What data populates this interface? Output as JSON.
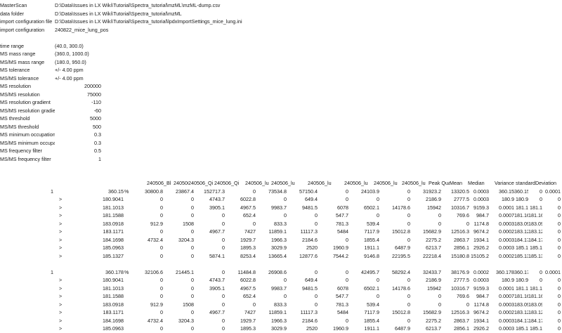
{
  "meta": {
    "MasterScan": "D:\\Data\\Issues in LX Wiki\\Tutorial\\Spectra_tutorial\\mzML\\mzML-dump.csv",
    "data folder": "D:\\Data\\Issues in LX Wiki\\Tutorial\\Spectra_tutorial\\mzML",
    "import configuration file": "D:\\Data\\Issues in LX Wiki\\Tutorial\\Spectra_tutorial\\lpdxImportSettings_mice_lung.ini",
    "import configuration": "240822_mice_lung_pos"
  },
  "meta_order": [
    "MasterScan",
    "data folder",
    "import configuration file",
    "import configuration"
  ],
  "meta_labels": [
    "MasterScan",
    "data folder",
    "import configuration file",
    "import configuration"
  ],
  "params": [
    {
      "label": "time range",
      "value": "(40.0, 300.0)",
      "align": "l"
    },
    {
      "label": "MS mass range",
      "value": "(360.0, 1000.0)",
      "align": "l"
    },
    {
      "label": "MS/MS mass range",
      "value": "(180.0, 950.0)",
      "align": "l"
    },
    {
      "label": "MS tolerance",
      "value": "+/- 4.00 ppm",
      "align": "l"
    },
    {
      "label": "MS/MS tolerance",
      "value": "+/- 4.00 ppm",
      "align": "l"
    },
    {
      "label": "MS resolution",
      "value": "200000",
      "align": "r"
    },
    {
      "label": "MS/MS resolution",
      "value": "75000",
      "align": "r"
    },
    {
      "label": "MS resolution gradient",
      "value": "-110",
      "align": "r"
    },
    {
      "label": "MS/MS resolution gradie",
      "value": "-60",
      "align": "r"
    },
    {
      "label": "MS threshold",
      "value": "5000",
      "align": "r"
    },
    {
      "label": "MS/MS threshold",
      "value": "500",
      "align": "r"
    },
    {
      "label": "MS minimum occupation",
      "value": "0.3",
      "align": "r"
    },
    {
      "label": "MS/MS minimum occupa",
      "value": "0.3",
      "align": "r"
    },
    {
      "label": "MS frequency filter",
      "value": "0.5",
      "align": "r"
    },
    {
      "label": "MS/MS frequency filter",
      "value": "1",
      "align": "r"
    }
  ],
  "headers": [
    "240506_Bl",
    "240506_Bl",
    "240506_Qi",
    "240506_Qi",
    "240506_lu",
    "240506_lu",
    "240506_lu",
    "240506_lu",
    "240506_lu",
    "240506_lu",
    "Peak Qual",
    "Mean",
    "Median",
    "Variance",
    "standardDeviation"
  ],
  "blocks": [
    {
      "index": "1",
      "mass": "360.15",
      "unit": "%",
      "values": [
        "30800.8",
        "23867.4",
        "152717.3",
        "0",
        "73534.8",
        "57150.4",
        "0",
        "24103.9",
        "0",
        "31923.2",
        "13320.5",
        "0.0003",
        "360.15",
        "360.15",
        "0",
        "0.0001"
      ],
      "rows": [
        {
          "marker": ">",
          "mz": "180.9041",
          "vals": [
            "0",
            "0",
            "4743.7",
            "6022.8",
            "0",
            "649.4",
            "0",
            "0",
            "0",
            "2186.9",
            "2777.5",
            "0.0003",
            "180.9",
            "180.9",
            "0",
            "0"
          ]
        },
        {
          "marker": ">",
          "mz": "181.1013",
          "vals": [
            "0",
            "0",
            "3905.1",
            "4967.5",
            "9983.7",
            "9481.5",
            "6078",
            "6502.1",
            "14178.6",
            "15942",
            "10316.7",
            "9159.3",
            "0.0001",
            "181.1",
            "181.1",
            "0",
            "0"
          ]
        },
        {
          "marker": ">",
          "mz": "181.1588",
          "vals": [
            "0",
            "0",
            "0",
            "652.4",
            "0",
            "0",
            "547.7",
            "0",
            "0",
            "0",
            "769.6",
            "984.7",
            "0.0007",
            "181.16",
            "181.16",
            "0",
            "0"
          ]
        },
        {
          "marker": ">",
          "mz": "183.0918",
          "vals": [
            "912.9",
            "1508",
            "0",
            "0",
            "833.3",
            "0",
            "781.3",
            "539.4",
            "0",
            "0",
            "0",
            "1174.8",
            "0.0003",
            "183.09",
            "183.09",
            "0",
            "0"
          ]
        },
        {
          "marker": ">",
          "mz": "183.1171",
          "vals": [
            "0",
            "0",
            "4967.7",
            "7427",
            "11859.1",
            "11117.3",
            "5484",
            "7117.9",
            "15012.8",
            "15682.9",
            "12516.3",
            "9674.2",
            "0.0002",
            "183.12",
            "183.12",
            "0",
            "0"
          ]
        },
        {
          "marker": ">",
          "mz": "184.1698",
          "vals": [
            "4732.4",
            "3204.3",
            "0",
            "1929.7",
            "1966.3",
            "2184.6",
            "0",
            "1855.4",
            "0",
            "2275.2",
            "2863.7",
            "1934.1",
            "0.0003",
            "184.17",
            "184.17",
            "0",
            "0"
          ]
        },
        {
          "marker": ">",
          "mz": "185.0963",
          "vals": [
            "0",
            "0",
            "0",
            "1895.3",
            "3029.9",
            "2520",
            "1960.9",
            "1911.1",
            "6487.9",
            "6213.7",
            "2856.1",
            "2926.2",
            "0.0003",
            "185.1",
            "185.1",
            "0",
            "0"
          ]
        },
        {
          "marker": ">",
          "mz": "185.1327",
          "vals": [
            "0",
            "0",
            "5874.1",
            "8253.4",
            "13665.4",
            "12877.6",
            "7544.2",
            "9146.8",
            "22195.5",
            "22218.4",
            "15180.8",
            "15105.2",
            "0.0002",
            "185.13",
            "185.13",
            "0",
            "0"
          ]
        }
      ]
    },
    {
      "index": "1",
      "mass": "360.178",
      "unit": "%",
      "values": [
        "32106.6",
        "21445.1",
        "0",
        "11484.8",
        "26908.6",
        "0",
        "0",
        "42495.7",
        "58292.4",
        "32433.7",
        "38176.9",
        "0.0002",
        "360.178",
        "360.178",
        "0",
        "0.0001"
      ],
      "rows": [
        {
          "marker": ">",
          "mz": "180.9041",
          "vals": [
            "0",
            "0",
            "4743.7",
            "6022.8",
            "0",
            "649.4",
            "0",
            "0",
            "0",
            "2186.9",
            "2777.5",
            "0.0003",
            "180.9",
            "180.9",
            "0",
            "0"
          ]
        },
        {
          "marker": ">",
          "mz": "181.1013",
          "vals": [
            "0",
            "0",
            "3905.1",
            "4967.5",
            "9983.7",
            "9481.5",
            "6078",
            "6502.1",
            "14178.6",
            "15942",
            "10316.7",
            "9159.3",
            "0.0001",
            "181.1",
            "181.1",
            "0",
            "0"
          ]
        },
        {
          "marker": ">",
          "mz": "181.1588",
          "vals": [
            "0",
            "0",
            "0",
            "652.4",
            "0",
            "0",
            "547.7",
            "0",
            "0",
            "0",
            "769.6",
            "984.7",
            "0.0007",
            "181.16",
            "181.16",
            "0",
            "0"
          ]
        },
        {
          "marker": ">",
          "mz": "183.0918",
          "vals": [
            "912.9",
            "1508",
            "0",
            "0",
            "833.3",
            "0",
            "781.3",
            "539.4",
            "0",
            "0",
            "0",
            "1174.8",
            "0.0003",
            "183.09",
            "183.09",
            "0",
            "0"
          ]
        },
        {
          "marker": ">",
          "mz": "183.1171",
          "vals": [
            "0",
            "0",
            "4967.7",
            "7427",
            "11859.1",
            "11117.3",
            "5484",
            "7117.9",
            "15012.8",
            "15682.9",
            "12516.3",
            "9674.2",
            "0.0002",
            "183.12",
            "183.12",
            "0",
            "0"
          ]
        },
        {
          "marker": ">",
          "mz": "184.1698",
          "vals": [
            "4732.4",
            "3204.3",
            "0",
            "1929.7",
            "1966.3",
            "2184.6",
            "0",
            "1855.4",
            "0",
            "2275.2",
            "2863.7",
            "1934.1",
            "0.0003",
            "184.17",
            "184.17",
            "0",
            "0"
          ]
        },
        {
          "marker": ">",
          "mz": "185.0963",
          "vals": [
            "0",
            "0",
            "0",
            "1895.3",
            "3029.9",
            "2520",
            "1960.9",
            "1911.1",
            "6487.9",
            "6213.7",
            "2856.1",
            "2926.2",
            "0.0003",
            "185.1",
            "185.1",
            "0",
            "0"
          ]
        }
      ]
    }
  ]
}
